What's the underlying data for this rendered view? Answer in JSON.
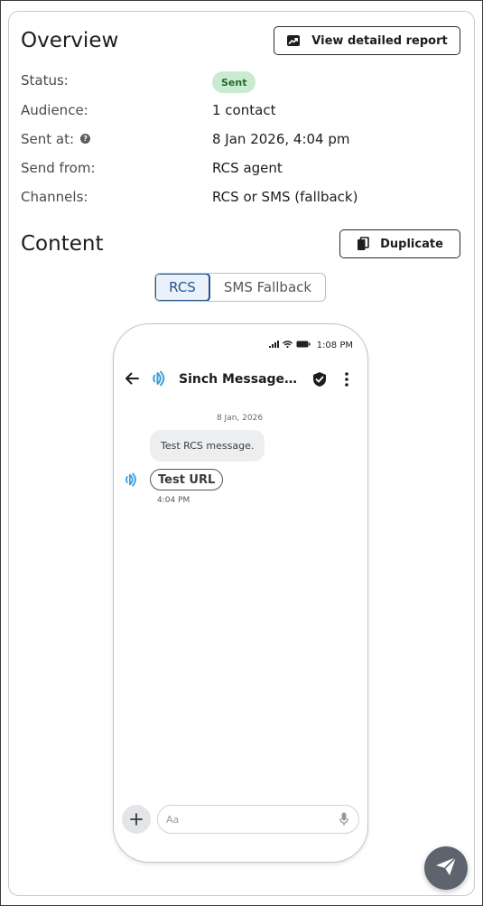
{
  "overview": {
    "title": "Overview",
    "view_report_label": "View detailed report",
    "status_label": "Status:",
    "status_value": "Sent",
    "audience_label": "Audience:",
    "audience_value": "1 contact",
    "sent_at_label": "Sent at:",
    "sent_at_help_glyph": "?",
    "sent_at_value": "8 Jan 2026, 4:04 pm",
    "send_from_label": "Send from:",
    "send_from_value": "RCS agent",
    "channels_label": "Channels:",
    "channels_value": "RCS or SMS (fallback)"
  },
  "content": {
    "title": "Content",
    "duplicate_label": "Duplicate",
    "tabs": [
      {
        "label": "RCS",
        "active": true
      },
      {
        "label": "SMS Fallback",
        "active": false
      }
    ]
  },
  "phone": {
    "time": "1:08 PM",
    "agent_name": "Sinch MessageMe…",
    "date_separator": "8 Jan, 2026",
    "message_text": "Test RCS message.",
    "suggestion_chip": "Test URL",
    "message_time": "4:04 PM",
    "compose_placeholder": "Aa"
  },
  "icons": {
    "report": "trend-chart-icon",
    "duplicate": "copy-icon",
    "back": "arrow-left-icon",
    "agent": "agent-logo-icon",
    "verified": "verified-shield-icon",
    "menu": "kebab-menu-icon",
    "add": "plus-icon",
    "mic": "microphone-icon",
    "send": "send-icon"
  },
  "colors": {
    "status_badge_bg": "#c9ecd0",
    "status_badge_text": "#26682f",
    "tab_active": "#23558f",
    "agent_logo": "#3fa0d6",
    "fab_bg": "#5d646d"
  }
}
